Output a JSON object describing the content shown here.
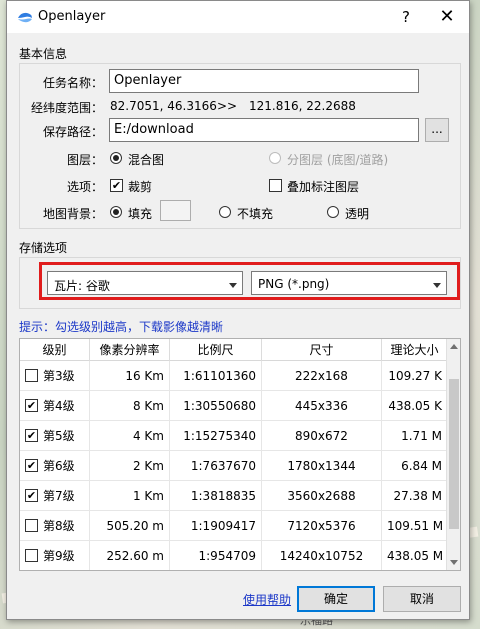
{
  "window": {
    "title": "Openlayer",
    "help_label": "?",
    "close_label": "✕"
  },
  "basic": {
    "section": "基本信息",
    "task_name_label": "任务名称：",
    "task_name_value": "Openlayer",
    "range_label": "经纬度范围：",
    "range_start": "82.7051, 46.3166",
    "range_sep": ">>",
    "range_end": "121.816, 22.2688",
    "path_label": "保存路径：",
    "path_value": "E:/download",
    "browse_label": "...",
    "layer_label": "图层：",
    "layer_mixed": "混合图",
    "layer_split": "分图层 (底图/道路)",
    "options_label": "选项：",
    "option_crop": "裁剪",
    "option_overlay": "叠加标注图层",
    "bg_label": "地图背景：",
    "bg_fill": "填充",
    "bg_nofill": "不填充",
    "bg_transparent": "透明"
  },
  "storage": {
    "section": "存储选项",
    "tile_source": "瓦片: 谷歌",
    "format": "PNG (*.png)"
  },
  "tip": "提示：勾选级别越高，下载影像越清晰",
  "table": {
    "headers": [
      "级别",
      "像素分辨率",
      "比例尺",
      "尺寸",
      "理论大小"
    ],
    "rows": [
      {
        "checked": false,
        "level": "第3级",
        "res": "16 Km",
        "scale": "1:61101360",
        "size": "222x168",
        "est": "109.27 K"
      },
      {
        "checked": true,
        "level": "第4级",
        "res": "8 Km",
        "scale": "1:30550680",
        "size": "445x336",
        "est": "438.05 K"
      },
      {
        "checked": true,
        "level": "第5级",
        "res": "4 Km",
        "scale": "1:15275340",
        "size": "890x672",
        "est": "1.71 M"
      },
      {
        "checked": true,
        "level": "第6级",
        "res": "2 Km",
        "scale": "1:7637670",
        "size": "1780x1344",
        "est": "6.84 M"
      },
      {
        "checked": true,
        "level": "第7级",
        "res": "1 Km",
        "scale": "1:3818835",
        "size": "3560x2688",
        "est": "27.38 M"
      },
      {
        "checked": false,
        "level": "第8级",
        "res": "505.20 m",
        "scale": "1:1909417",
        "size": "7120x5376",
        "est": "109.51 M"
      },
      {
        "checked": false,
        "level": "第9级",
        "res": "252.60 m",
        "scale": "1:954709",
        "size": "14240x10752",
        "est": "438.05 M"
      }
    ]
  },
  "footer": {
    "help_link": "使用帮助",
    "ok": "确定",
    "cancel": "取消"
  },
  "map_labels": {
    "road_text": "乐福路"
  },
  "colors": {
    "highlight": "#e01c1c",
    "link": "#1c38c8",
    "accent": "#0078d7"
  }
}
